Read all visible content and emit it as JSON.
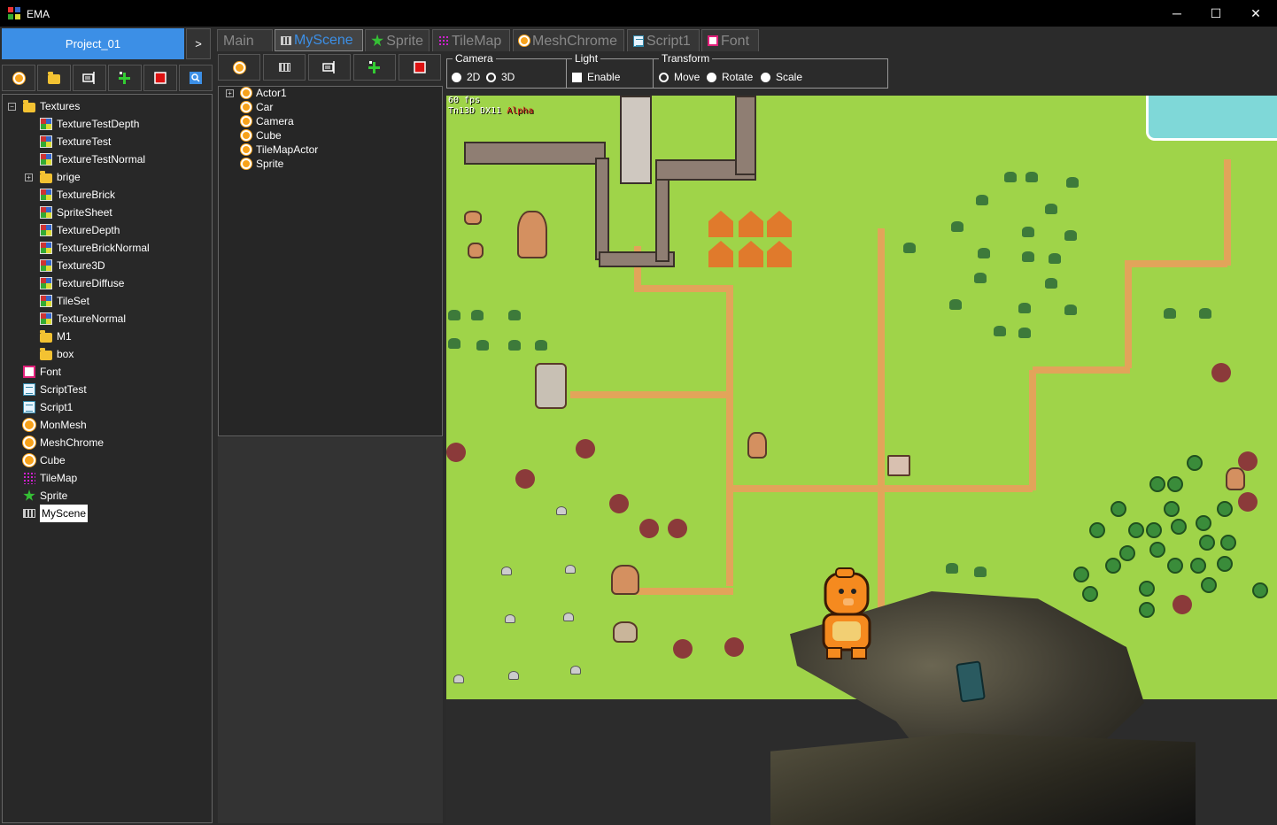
{
  "window": {
    "title": "EMA",
    "controls": {
      "minimize": "─",
      "maximize": "☐",
      "close": "✕"
    }
  },
  "left_panel": {
    "project_button": "Project_01",
    "next_button": ">",
    "toolbar": [
      "add-actor-icon",
      "folder-icon",
      "rename-icon",
      "add-icon",
      "delete-icon",
      "search-icon"
    ],
    "tree": [
      {
        "label": "Textures",
        "type": "folder",
        "level": 0,
        "expander": "−"
      },
      {
        "label": "TextureTestDepth",
        "type": "texture",
        "level": 1
      },
      {
        "label": "TextureTest",
        "type": "texture",
        "level": 1
      },
      {
        "label": "TextureTestNormal",
        "type": "texture",
        "level": 1
      },
      {
        "label": "brige",
        "type": "folder",
        "level": 1,
        "expander": "+"
      },
      {
        "label": "TextureBrick",
        "type": "texture",
        "level": 1
      },
      {
        "label": "SpriteSheet",
        "type": "texture",
        "level": 1
      },
      {
        "label": "TextureDepth",
        "type": "texture",
        "level": 1
      },
      {
        "label": "TextureBrickNormal",
        "type": "texture",
        "level": 1
      },
      {
        "label": "Texture3D",
        "type": "texture",
        "level": 1
      },
      {
        "label": "TextureDiffuse",
        "type": "texture",
        "level": 1
      },
      {
        "label": "TileSet",
        "type": "texture",
        "level": 1
      },
      {
        "label": "TextureNormal",
        "type": "texture",
        "level": 1
      },
      {
        "label": "M1",
        "type": "folder",
        "level": 1
      },
      {
        "label": "box",
        "type": "folder",
        "level": 1
      },
      {
        "label": "Font",
        "type": "font",
        "level": 0
      },
      {
        "label": "ScriptTest",
        "type": "script",
        "level": 0
      },
      {
        "label": "Script1",
        "type": "script",
        "level": 0
      },
      {
        "label": "MonMesh",
        "type": "mesh",
        "level": 0
      },
      {
        "label": "MeshChrome",
        "type": "mesh",
        "level": 0
      },
      {
        "label": "Cube",
        "type": "mesh",
        "level": 0
      },
      {
        "label": "TileMap",
        "type": "tilemap",
        "level": 0
      },
      {
        "label": "Sprite",
        "type": "sprite",
        "level": 0
      },
      {
        "label": "MyScene",
        "type": "scene",
        "level": 0,
        "selected": true
      }
    ]
  },
  "tabs": [
    {
      "label": "Main",
      "icon": ""
    },
    {
      "label": "MyScene",
      "icon": "scene",
      "active": true
    },
    {
      "label": "Sprite",
      "icon": "sprite"
    },
    {
      "label": "TileMap",
      "icon": "tilemap"
    },
    {
      "label": "MeshChrome",
      "icon": "mesh"
    },
    {
      "label": "Script1",
      "icon": "script"
    },
    {
      "label": "Font",
      "icon": "font"
    }
  ],
  "scene_panel": {
    "toolbar": [
      "add-actor-icon",
      "scene-icon",
      "rename-icon",
      "add-icon",
      "delete-icon"
    ],
    "tree": [
      {
        "label": "Actor1",
        "expander": "+"
      },
      {
        "label": "Car"
      },
      {
        "label": "Camera"
      },
      {
        "label": "Cube"
      },
      {
        "label": "TileMapActor"
      },
      {
        "label": "Sprite"
      }
    ]
  },
  "options": {
    "camera": {
      "title": "Camera",
      "opt_2d": "2D",
      "opt_3d": "3D"
    },
    "light": {
      "title": "Light",
      "enable": "Enable"
    },
    "transform": {
      "title": "Transform",
      "move": "Move",
      "rotate": "Rotate",
      "scale": "Scale"
    }
  },
  "viewport": {
    "hud_line1": "60 fps",
    "hud_line2a": "Tn13D DX11",
    "hud_line2b": "Alpha"
  }
}
